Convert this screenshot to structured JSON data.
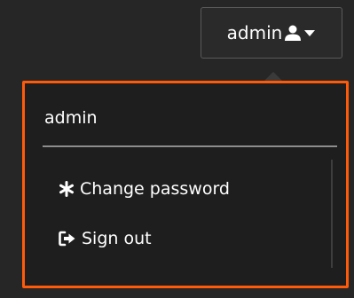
{
  "user_button": {
    "username": "admin",
    "user_icon": "user-icon",
    "caret_icon": "caret-down-icon"
  },
  "dropdown": {
    "header": "admin",
    "items": [
      {
        "label": "Change password",
        "icon": "asterisk-icon"
      },
      {
        "label": "Sign out",
        "icon": "sign-out-icon"
      }
    ]
  },
  "colors": {
    "background": "#262626",
    "highlight_border": "#ff5a0a",
    "text": "#ffffff"
  }
}
